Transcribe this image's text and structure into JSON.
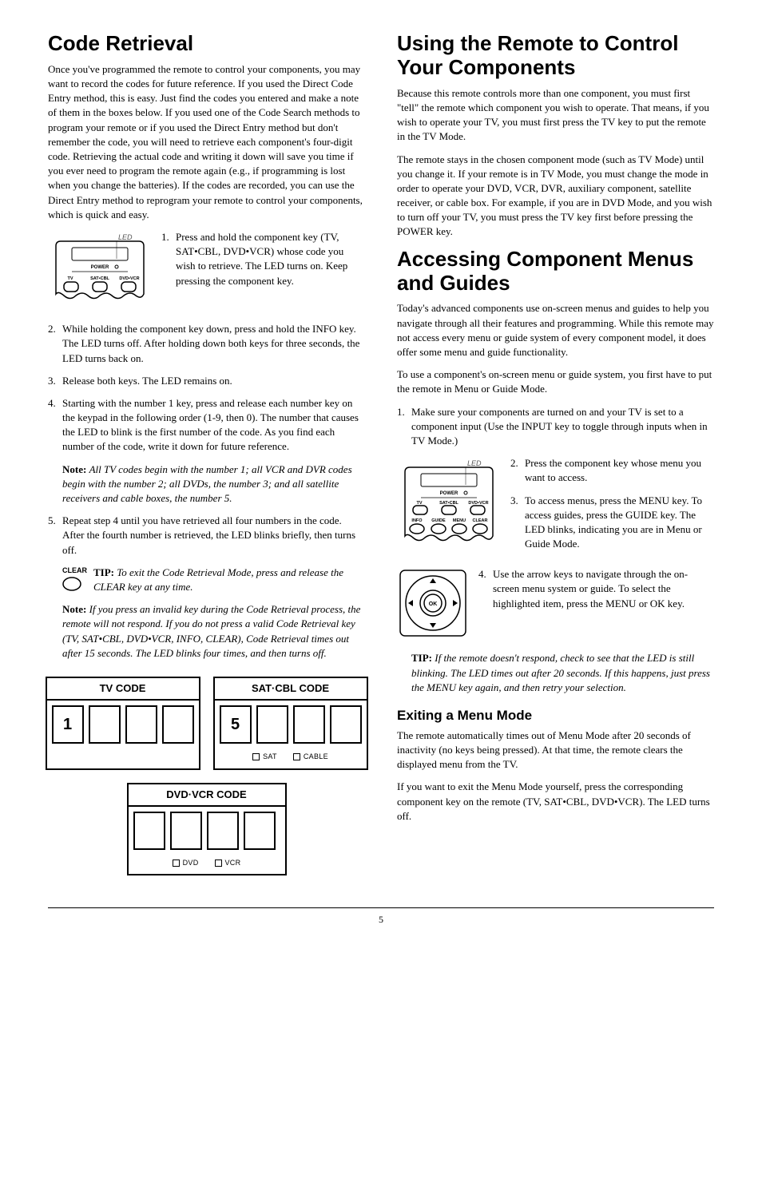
{
  "left": {
    "h1": "Code Retrieval",
    "intro": "Once you've programmed the remote to control your components, you may want to record the codes for future reference. If you used the Direct Code Entry method, this is easy. Just find the codes you entered and make a note of them in the boxes below. If you used one of the Code Search methods to program your remote or if you used the Direct Entry method but don't remember the code, you will need to retrieve each component's four-digit code. Retrieving the actual code and writing it down will save you time if you ever need to program the remote again (e.g., if programming is lost when you change the batteries). If the codes are recorded, you can use the Direct Entry method to reprogram your remote to control your components, which is quick and easy.",
    "led_label": "LED",
    "step1": "Press and hold the component key (TV, SAT•CBL, DVD•VCR) whose code you wish to retrieve. The LED turns on. Keep pressing the component key.",
    "step2": "While holding the component key down, press and hold the INFO key. The LED turns off. After holding down both keys for three seconds, the LED turns back on.",
    "step3": "Release both keys. The LED remains on.",
    "step4": "Starting with the number 1 key, press and release each number key on the keypad in the following order (1-9, then 0). The number that causes the LED to blink is the first number of the code. As you find each number of the code, write it down for future reference.",
    "note1_label": "Note: ",
    "note1": "All TV codes begin with the number 1; all VCR and DVR codes begin with the number 2; all DVDs, the number 3; and all satellite receivers and cable boxes, the number 5.",
    "step5": "Repeat step 4 until you have retrieved all four numbers in the code. After the fourth number is retrieved, the LED blinks briefly, then turns off.",
    "clear_label": "CLEAR",
    "tip_label": "TIP: ",
    "tip": "To exit the Code Retrieval Mode, press and release the CLEAR key at any time.",
    "note2_label": "Note: ",
    "note2": "If you press an invalid key during the Code Retrieval process, the remote will not respond. If you do not press a valid Code Retrieval key (TV, SAT•CBL, DVD•VCR, INFO, CLEAR), Code Retrieval times out after 15 seconds. The LED blinks four times, and then turns off.",
    "codebox1_title": "TV CODE",
    "codebox1_val": "1",
    "codebox2_title": "SAT·CBL CODE",
    "codebox2_val": "5",
    "codebox2_cb1": "SAT",
    "codebox2_cb2": "CABLE",
    "codebox3_title": "DVD·VCR CODE",
    "codebox3_cb1": "DVD",
    "codebox3_cb2": "VCR"
  },
  "right": {
    "h1a": "Using the Remote to Control Your Components",
    "p1": "Because this remote controls more than one component, you must first \"tell\" the remote which component you wish to operate. That means, if you wish to operate your TV, you must first press the TV key to put the remote in the TV Mode.",
    "p2": "The remote stays in the chosen component mode (such as TV Mode) until you change it. If your remote is in TV Mode, you must change the mode in order to operate your DVD, VCR, DVR, auxiliary component, satellite receiver, or cable box. For example, if you are in DVD Mode, and you wish to turn off your TV, you must press the TV key first before pressing the POWER key.",
    "h1b": "Accessing Component Menus and Guides",
    "p3": "Today's advanced components use on-screen menus and guides to help you navigate through all their features and programming. While this remote may not access every menu or guide system of every component model, it does offer some menu and guide functionality.",
    "p4": "To use a component's on-screen menu or guide system, you first have to put the remote in Menu or Guide Mode.",
    "step1": "Make sure your components are turned on and your TV is set to a component input (Use the INPUT key to toggle through inputs when in TV Mode.)",
    "led_label": "LED",
    "step2": "Press the component key whose menu you want to access.",
    "step3": "To access menus, press the MENU key. To access guides, press the GUIDE key. The LED blinks, indicating you are in Menu or Guide Mode.",
    "step4": "Use the arrow keys to navigate through the on-screen menu system or guide. To select the highlighted item, press the MENU or OK key.",
    "tip_label": "TIP: ",
    "tip": "If the remote doesn't respond, check to see that the LED is still blinking. The LED times out after 20 seconds. If this happens, just press the MENU key again, and then retry your selection.",
    "h2": "Exiting a Menu Mode",
    "p5": "The remote automatically times out of Menu Mode after 20 seconds of inactivity (no keys being pressed). At that time, the remote clears the displayed menu from the TV.",
    "p6": "If you want to exit the Menu Mode yourself, press the corresponding component key on the remote (TV, SAT•CBL, DVD•VCR). The LED turns off."
  },
  "page_number": "5"
}
